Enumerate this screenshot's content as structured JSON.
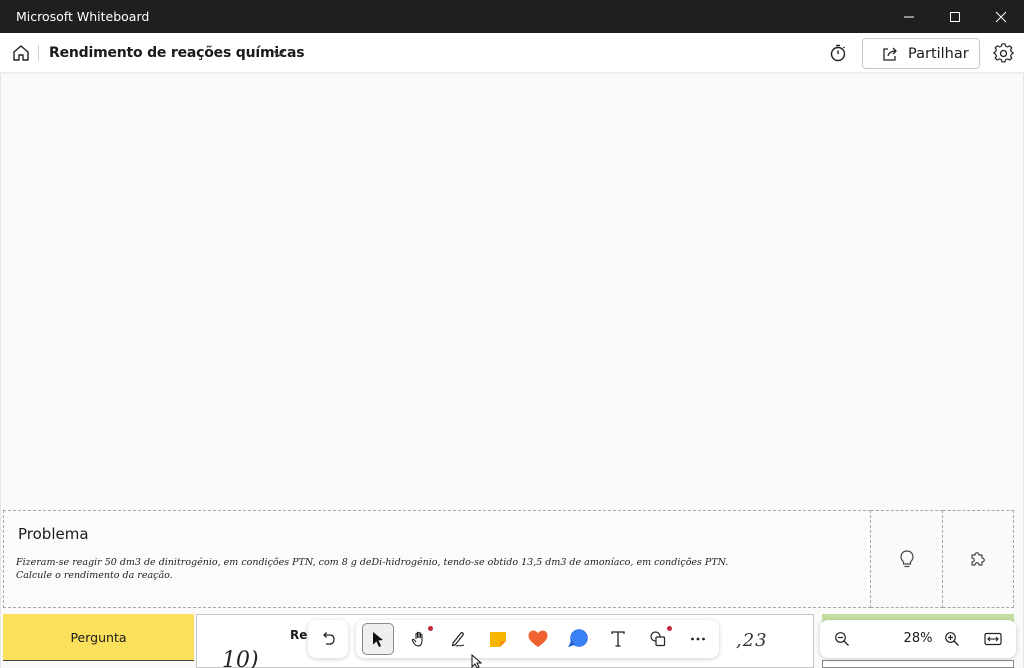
{
  "window": {
    "title": "Microsoft Whiteboard",
    "controls": [
      "minimize",
      "maximize",
      "close"
    ]
  },
  "header": {
    "board_title": "Rendimento de reações químicas",
    "share_label": "Partilhar"
  },
  "problem": {
    "title": "Problema",
    "text_line1": "Fizeram-se reagir 50 dm3 de dinitrogénio, em condições PTN, com 8 g deDi-hidrogénio, tendo-se obtido 13,5 dm3 de amoníaco, em condições PTN.",
    "text_line2": "Calcule o rendimento da reação."
  },
  "lower": {
    "pergunta_label": "Pergunta",
    "resposta_label": "Res",
    "handwriting_left": "10)",
    "handwriting_right": ",23"
  },
  "toolbar": {
    "tools": [
      "undo",
      "select",
      "pan",
      "pen",
      "sticky-note",
      "reactions",
      "chat",
      "text",
      "shapes",
      "more"
    ],
    "selected_tool": "select"
  },
  "zoom": {
    "level": "28%"
  },
  "colors": {
    "titlebar": "#1f1f1f",
    "pergunta_bg": "#fbe05c",
    "green_strip": "#c4dea2",
    "notification_dot": "#c4263c",
    "sticky_note": "#f7b500",
    "heart": "#f0622f",
    "chat": "#3b82f6"
  }
}
